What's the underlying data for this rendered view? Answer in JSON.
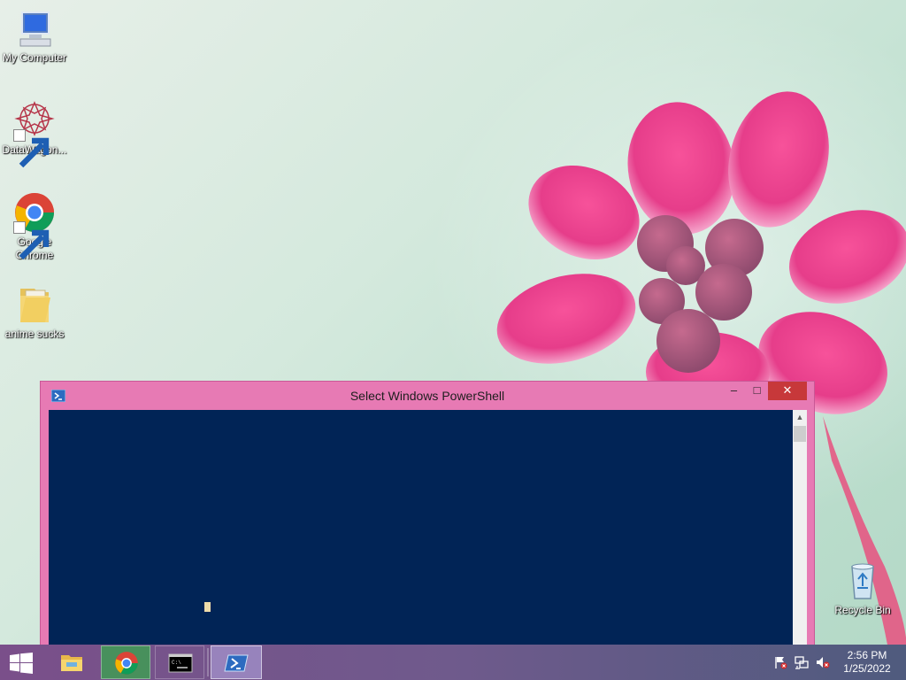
{
  "desktop": {
    "icons": [
      {
        "label": "My Computer",
        "icon": "computer-icon"
      },
      {
        "label": "DataWagon...",
        "icon": "datawagon-icon"
      },
      {
        "label": "Google Chrome",
        "icon": "chrome-icon"
      },
      {
        "label": "anime sucks",
        "icon": "folder-icon"
      },
      {
        "label": "Recycle Bin",
        "icon": "recycle-bin-icon"
      }
    ]
  },
  "window": {
    "title": "Select Windows PowerShell",
    "buttons": {
      "minimize": "–",
      "maximize": "□",
      "close": "✕"
    },
    "console_bg": "#012456",
    "scroll_up": "▲"
  },
  "taskbar": {
    "items": [
      "start-icon",
      "file-explorer-icon",
      "chrome-icon",
      "cmd-icon",
      "powershell-icon"
    ],
    "active": "powershell-icon"
  },
  "tray": {
    "icons": [
      "flag-icon",
      "network-icon",
      "volume-muted-icon"
    ],
    "time": "2:56 PM",
    "date": "1/25/2022"
  }
}
